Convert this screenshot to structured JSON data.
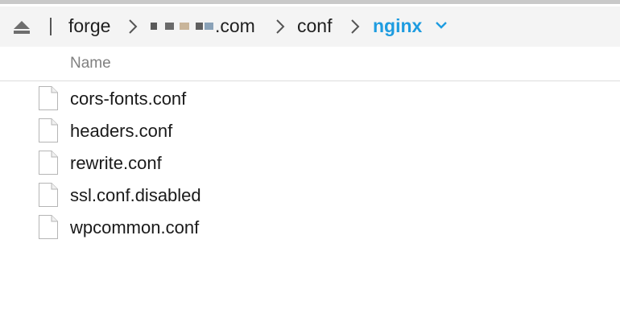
{
  "pathbar": {
    "eject_icon": "eject-icon",
    "crumbs": [
      "forge",
      ".com",
      "conf",
      "nginx"
    ],
    "accent_color": "#1e9ce0"
  },
  "list": {
    "column_header": "Name",
    "files": [
      "cors-fonts.conf",
      "headers.conf",
      "rewrite.conf",
      "ssl.conf.disabled",
      "wpcommon.conf"
    ]
  }
}
